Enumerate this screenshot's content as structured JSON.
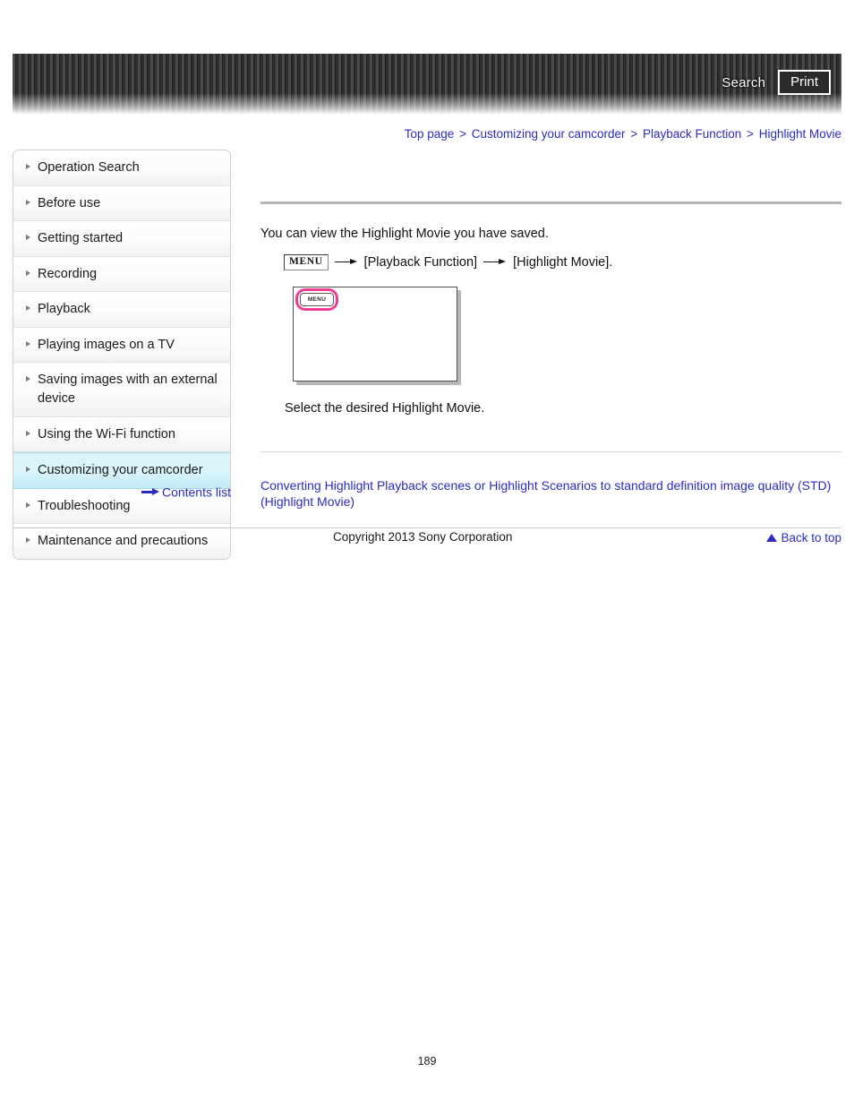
{
  "header": {
    "search_label": "Search",
    "print_label": "Print"
  },
  "breadcrumb": {
    "items": [
      {
        "label": "Top page"
      },
      {
        "label": "Customizing your camcorder"
      },
      {
        "label": "Playback Function"
      },
      {
        "label": "Highlight Movie"
      }
    ],
    "separator": ">"
  },
  "sidebar": {
    "items": [
      {
        "label": "Operation Search",
        "active": false
      },
      {
        "label": "Before use",
        "active": false
      },
      {
        "label": "Getting started",
        "active": false
      },
      {
        "label": "Recording",
        "active": false
      },
      {
        "label": "Playback",
        "active": false
      },
      {
        "label": "Playing images on a TV",
        "active": false
      },
      {
        "label": "Saving images with an external device",
        "active": false
      },
      {
        "label": "Using the Wi-Fi function",
        "active": false
      },
      {
        "label": "Customizing your camcorder",
        "active": true
      },
      {
        "label": "Troubleshooting",
        "active": false
      },
      {
        "label": "Maintenance and precautions",
        "active": false
      }
    ],
    "contents_list_label": "Contents list"
  },
  "main": {
    "intro": "You can view the Highlight Movie you have saved.",
    "menu_path": {
      "menu_badge": "MENU",
      "step1": "[Playback Function]",
      "step2": "[Highlight Movie]."
    },
    "illustration": {
      "soft_key_label": "MENU"
    },
    "select_text": "Select the desired Highlight Movie.",
    "related_link": "Converting Highlight Playback scenes or Highlight Scenarios to standard definition image quality (STD) (Highlight Movie)",
    "back_to_top_label": "Back to top"
  },
  "footer": {
    "copyright": "Copyright 2013 Sony Corporation",
    "page_number": "189"
  },
  "colors": {
    "link": "#2b2bc4",
    "highlight_ring": "#ee3d96",
    "active_nav": "#d8f4fb",
    "header_bar": "#3a3a3a"
  }
}
